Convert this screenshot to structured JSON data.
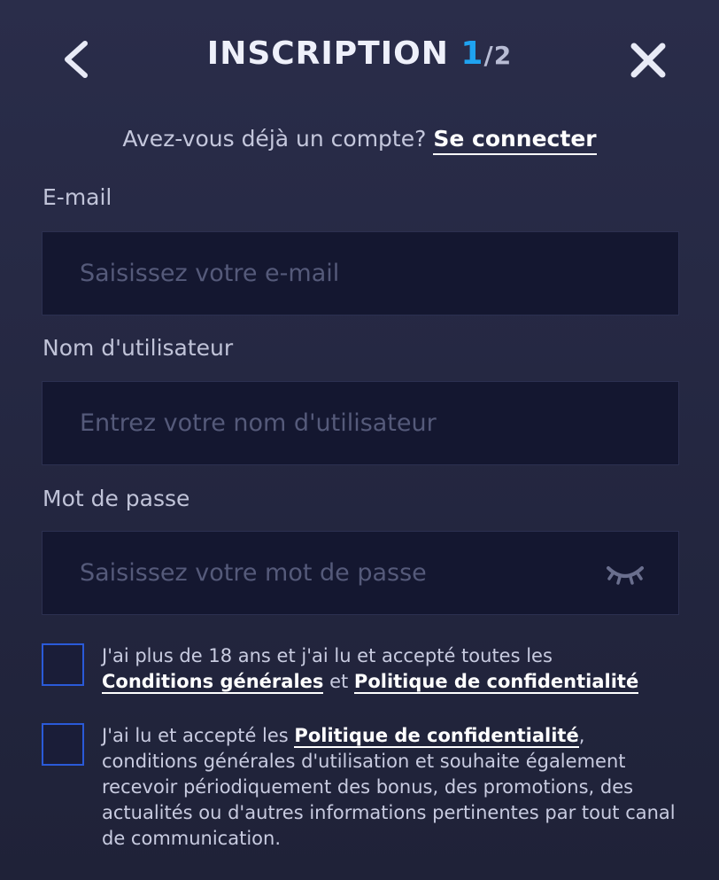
{
  "header": {
    "title": "INSCRIPTION",
    "step_current": "1",
    "step_separator": "/",
    "step_total": "2",
    "back_icon": "chevron-left-icon",
    "close_icon": "close-icon"
  },
  "login_prompt": {
    "text": "Avez-vous déjà un compte?",
    "link": "Se connecter"
  },
  "form": {
    "email": {
      "label": "E-mail",
      "placeholder": "Saisissez votre e-mail",
      "value": ""
    },
    "username": {
      "label": "Nom d'utilisateur",
      "placeholder": "Entrez votre nom d'utilisateur",
      "value": ""
    },
    "password": {
      "label": "Mot de passe",
      "placeholder": "Saisissez votre mot de passe",
      "value": "",
      "toggle_icon": "eye-closed-icon"
    }
  },
  "consents": {
    "age": {
      "checked": false,
      "text_before": "J'ai plus de 18 ans et j'ai lu et accepté toutes les",
      "link_terms": "Conditions générales",
      "text_and": "et",
      "link_privacy": "Politique de confidentialité"
    },
    "marketing": {
      "checked": false,
      "text_before": "J'ai lu et accepté les",
      "link_privacy": "Politique de confidentialité",
      "text_after": ", conditions générales d'utilisation et souhaite également recevoir périodiquement des bonus, des promotions, des actualités ou d'autres informations pertinentes par tout canal de communication."
    }
  },
  "colors": {
    "accent": "#1fa3f0",
    "checkbox_border": "#2a5ad8",
    "field_bg": "#141730"
  }
}
